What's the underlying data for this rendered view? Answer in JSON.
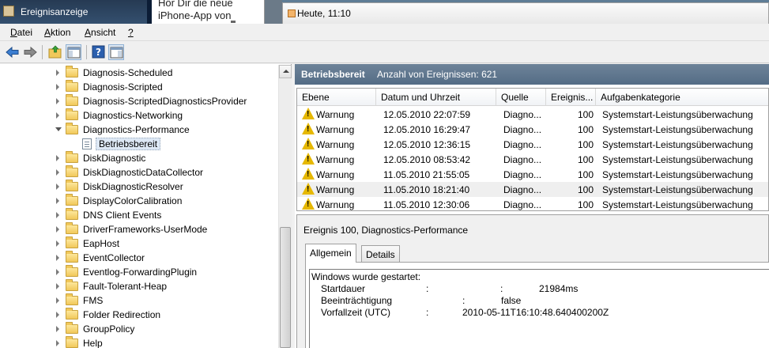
{
  "window": {
    "title": "Ereignisanzeige",
    "background_window_text": "Hör Dir die neue iPhone-App von",
    "background_tab_title": "Heute, 11:10"
  },
  "menu": {
    "items": [
      "Datei",
      "Aktion",
      "Ansicht",
      "?"
    ]
  },
  "toolbar": {
    "icons": [
      "back-arrow-icon",
      "forward-arrow-icon",
      "up-folder-icon",
      "show-hide-console-tree-icon",
      "help-icon",
      "action-pane-icon"
    ]
  },
  "tree": {
    "items": [
      {
        "label": "Diagnosis-Scheduled",
        "state": "collapsed"
      },
      {
        "label": "Diagnosis-Scripted",
        "state": "collapsed"
      },
      {
        "label": "Diagnosis-ScriptedDiagnosticsProvider",
        "state": "collapsed"
      },
      {
        "label": "Diagnostics-Networking",
        "state": "collapsed"
      },
      {
        "label": "Diagnostics-Performance",
        "state": "expanded"
      },
      {
        "label": "Betriebsbereit",
        "state": "selected-child"
      },
      {
        "label": "DiskDiagnostic",
        "state": "collapsed"
      },
      {
        "label": "DiskDiagnosticDataCollector",
        "state": "collapsed"
      },
      {
        "label": "DiskDiagnosticResolver",
        "state": "collapsed"
      },
      {
        "label": "DisplayColorCalibration",
        "state": "collapsed"
      },
      {
        "label": "DNS Client Events",
        "state": "collapsed"
      },
      {
        "label": "DriverFrameworks-UserMode",
        "state": "collapsed"
      },
      {
        "label": "EapHost",
        "state": "collapsed"
      },
      {
        "label": "EventCollector",
        "state": "collapsed"
      },
      {
        "label": "Eventlog-ForwardingPlugin",
        "state": "collapsed"
      },
      {
        "label": "Fault-Tolerant-Heap",
        "state": "collapsed"
      },
      {
        "label": "FMS",
        "state": "collapsed"
      },
      {
        "label": "Folder Redirection",
        "state": "collapsed"
      },
      {
        "label": "GroupPolicy",
        "state": "collapsed"
      },
      {
        "label": "Help",
        "state": "collapsed"
      }
    ]
  },
  "log_header": {
    "name": "Betriebsbereit",
    "count_text": "Anzahl von Ereignissen: 621"
  },
  "event_list": {
    "columns": [
      "Ebene",
      "Datum und Uhrzeit",
      "Quelle",
      "Ereignis...",
      "Aufgabenkategorie"
    ],
    "rows": [
      {
        "level": "Warnung",
        "datetime": "12.05.2010 22:07:59",
        "source": "Diagno...",
        "event_id": "100",
        "category": "Systemstart-Leistungsüberwachung"
      },
      {
        "level": "Warnung",
        "datetime": "12.05.2010 16:29:47",
        "source": "Diagno...",
        "event_id": "100",
        "category": "Systemstart-Leistungsüberwachung"
      },
      {
        "level": "Warnung",
        "datetime": "12.05.2010 12:36:15",
        "source": "Diagno...",
        "event_id": "100",
        "category": "Systemstart-Leistungsüberwachung"
      },
      {
        "level": "Warnung",
        "datetime": "12.05.2010 08:53:42",
        "source": "Diagno...",
        "event_id": "100",
        "category": "Systemstart-Leistungsüberwachung"
      },
      {
        "level": "Warnung",
        "datetime": "11.05.2010 21:55:05",
        "source": "Diagno...",
        "event_id": "100",
        "category": "Systemstart-Leistungsüberwachung"
      },
      {
        "level": "Warnung",
        "datetime": "11.05.2010 18:21:40",
        "source": "Diagno...",
        "event_id": "100",
        "category": "Systemstart-Leistungsüberwachung"
      },
      {
        "level": "Warnung",
        "datetime": "11.05.2010 12:30:06",
        "source": "Diagno...",
        "event_id": "100",
        "category": "Systemstart-Leistungsüberwachung"
      }
    ]
  },
  "detail": {
    "title": "Ereignis 100, Diagnostics-Performance",
    "tabs": [
      "Allgemein",
      "Details"
    ],
    "heading": "Windows wurde gestartet:",
    "fields": [
      {
        "label": "Startdauer",
        "sep": ":",
        "value": "21984ms"
      },
      {
        "label": "Beeinträchtigung",
        "sep": ":",
        "value": "false"
      },
      {
        "label": "Vorfallzeit (UTC)",
        "sep": ":",
        "value": "2010-05-11T16:10:48.640400200Z"
      }
    ]
  }
}
